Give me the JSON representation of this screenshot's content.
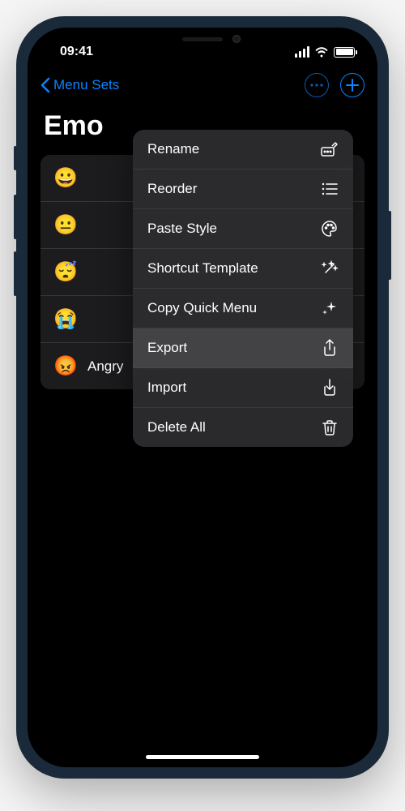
{
  "status": {
    "time": "09:41"
  },
  "nav": {
    "back_label": "Menu Sets"
  },
  "page": {
    "title": "Emo"
  },
  "list": {
    "items": [
      {
        "emoji": "😀",
        "label": ""
      },
      {
        "emoji": "😐",
        "label": ""
      },
      {
        "emoji": "😴",
        "label": ""
      },
      {
        "emoji": "😭",
        "label": ""
      },
      {
        "emoji": "😡",
        "label": "Angry"
      }
    ]
  },
  "menu": {
    "items": [
      {
        "label": "Rename",
        "icon": "rename-icon",
        "highlighted": false
      },
      {
        "label": "Reorder",
        "icon": "reorder-icon",
        "highlighted": false
      },
      {
        "label": "Paste Style",
        "icon": "palette-icon",
        "highlighted": false
      },
      {
        "label": "Shortcut Template",
        "icon": "wand-icon",
        "highlighted": false
      },
      {
        "label": "Copy Quick Menu",
        "icon": "sparkle-icon",
        "highlighted": false
      },
      {
        "label": "Export",
        "icon": "export-icon",
        "highlighted": true
      },
      {
        "label": "Import",
        "icon": "import-icon",
        "highlighted": false
      },
      {
        "label": "Delete All",
        "icon": "trash-icon",
        "highlighted": false
      }
    ]
  }
}
